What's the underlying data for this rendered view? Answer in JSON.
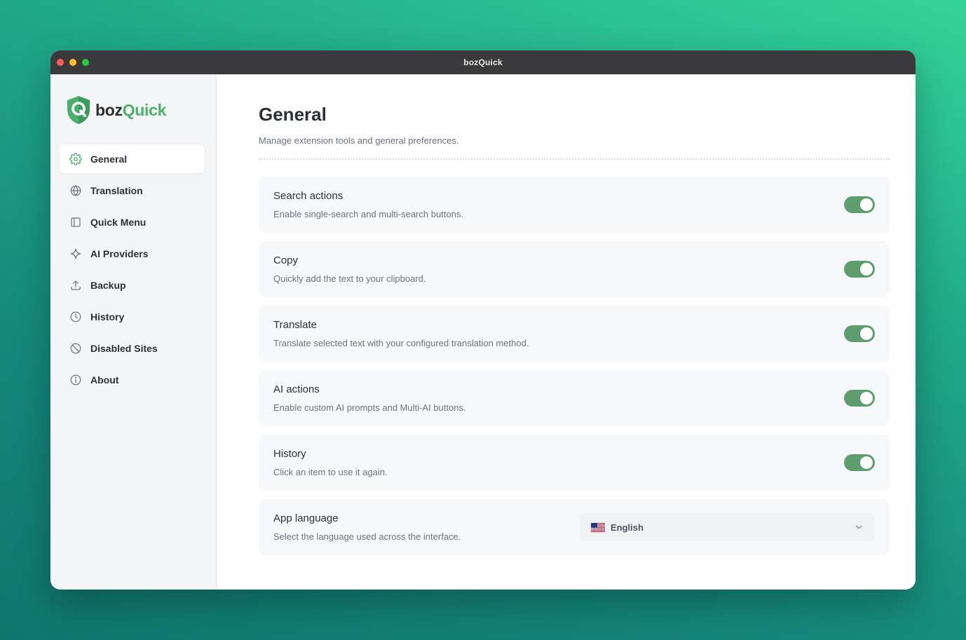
{
  "window": {
    "title": "bozQuick"
  },
  "logo": {
    "part1": "boz",
    "part2": "Quick"
  },
  "colors": {
    "accent": "#4caf6e",
    "toggle_on": "#5e9e6e"
  },
  "sidebar": {
    "items": [
      {
        "label": "General",
        "icon": "gear-icon",
        "active": true
      },
      {
        "label": "Translation",
        "icon": "globe-icon"
      },
      {
        "label": "Quick Menu",
        "icon": "panel-icon"
      },
      {
        "label": "AI Providers",
        "icon": "sparkle-icon"
      },
      {
        "label": "Backup",
        "icon": "upload-icon"
      },
      {
        "label": "History",
        "icon": "clock-icon"
      },
      {
        "label": "Disabled Sites",
        "icon": "ban-icon"
      },
      {
        "label": "About",
        "icon": "info-icon"
      }
    ]
  },
  "main": {
    "title": "General",
    "subtitle": "Manage extension tools and general preferences.",
    "settings": [
      {
        "title": "Search actions",
        "desc": "Enable single-search and multi-search buttons.",
        "enabled": true
      },
      {
        "title": "Copy",
        "desc": "Quickly add the text to your clipboard.",
        "enabled": true
      },
      {
        "title": "Translate",
        "desc": "Translate selected text with your configured translation method.",
        "enabled": true
      },
      {
        "title": "AI actions",
        "desc": "Enable custom AI prompts and Multi-AI buttons.",
        "enabled": true
      },
      {
        "title": "History",
        "desc": "Click an item to use it again.",
        "enabled": true
      }
    ],
    "language": {
      "title": "App language",
      "desc": "Select the language used across the interface.",
      "selected": "English",
      "flag_icon": "us-flag-icon"
    }
  }
}
